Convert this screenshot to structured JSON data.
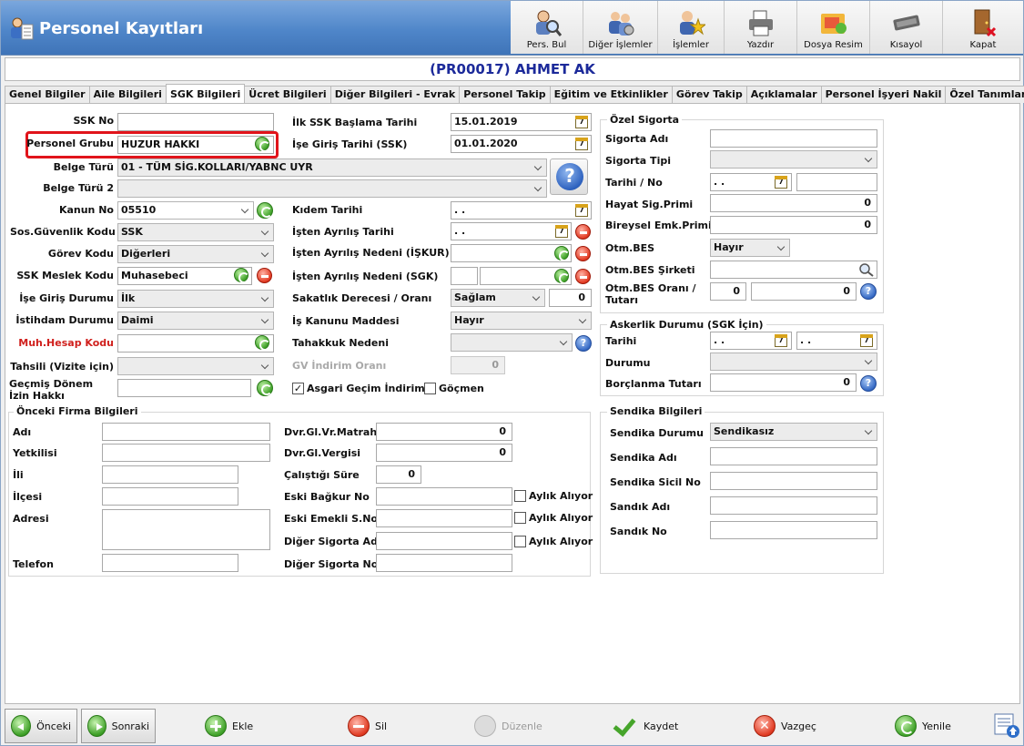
{
  "window": {
    "title": "Personel Kayıtları"
  },
  "toolbar": [
    {
      "label": "Pers. Bul",
      "icon": "person-search-icon"
    },
    {
      "label": "Diğer İşlemler",
      "icon": "people-gear-icon"
    },
    {
      "label": "İşlemler",
      "icon": "person-star-icon"
    },
    {
      "label": "Yazdır",
      "icon": "printer-icon"
    },
    {
      "label": "Dosya Resim",
      "icon": "folder-image-icon"
    },
    {
      "label": "Kısayol",
      "icon": "keyboard-icon"
    },
    {
      "label": "Kapat",
      "icon": "exit-door-icon"
    }
  ],
  "header": {
    "record_title": "(PR00017) AHMET AK"
  },
  "tabs": [
    "Genel Bilgiler",
    "Aile Bilgileri",
    "SGK Bilgileri",
    "Ücret Bilgileri",
    "Diğer Bilgileri - Evrak",
    "Personel Takip",
    "Eğitim ve Etkinlikler",
    "Görev Takip",
    "Açıklamalar",
    "Personel İşyeri Nakil",
    "Özel Tanımlar"
  ],
  "active_tab": "SGK Bilgileri",
  "sgk": {
    "ssk_no": {
      "label": "SSK No",
      "value": ""
    },
    "personel_grubu": {
      "label": "Personel Grubu",
      "value": "HUZUR HAKKI"
    },
    "belge_turu": {
      "label": "Belge Türü",
      "value": "01 - TÜM SİG.KOLLARI/YABNC UYR"
    },
    "belge_turu2": {
      "label": "Belge Türü 2",
      "value": ""
    },
    "kanun_no": {
      "label": "Kanun No",
      "value": "05510"
    },
    "sos_guvenlik": {
      "label": "Sos.Güvenlik Kodu",
      "value": "SSK"
    },
    "gorev_kodu": {
      "label": "Görev Kodu",
      "value": "Diğerleri"
    },
    "ssk_meslek": {
      "label": "SSK Meslek Kodu",
      "value": "Muhasebeci"
    },
    "ise_giris_durumu": {
      "label": "İşe Giriş Durumu",
      "value": "İlk"
    },
    "istihdam": {
      "label": "İstihdam Durumu",
      "value": "Daimi"
    },
    "muh_hesap": {
      "label": "Muh.Hesap Kodu",
      "value": ""
    },
    "tahsili": {
      "label": "Tahsili (Vizite için)",
      "value": ""
    },
    "gecmis_izin": {
      "label": "Geçmiş Dönem İzin Hakkı",
      "value": ""
    },
    "ilk_ssk": {
      "label": "İlk SSK Başlama Tarihi",
      "value": "15.01.2019"
    },
    "ise_giris_tarihi": {
      "label": "İşe Giriş Tarihi (SSK)",
      "value": "01.01.2020"
    },
    "kidem": {
      "label": "Kıdem Tarihi",
      "value": ". ."
    },
    "isten_ayrilis": {
      "label": "İşten Ayrılış Tarihi",
      "value": ". ."
    },
    "ayrilis_iskur": {
      "label": "İşten Ayrılış Nedeni (İŞKUR)",
      "value": ""
    },
    "ayrilis_sgk": {
      "label": "İşten Ayrılış Nedeni (SGK)",
      "value": ""
    },
    "sakatlik": {
      "label": "Sakatlık Derecesi / Oranı",
      "value": "Sağlam",
      "oran": "0"
    },
    "is_kanunu": {
      "label": "İş Kanunu Maddesi",
      "value": "Hayır"
    },
    "tahakkuk": {
      "label": "Tahakkuk Nedeni",
      "value": ""
    },
    "gv_indirim": {
      "label": "GV İndirim Oranı",
      "value": "0"
    },
    "asgari": {
      "label": "Asgari Geçim İndirimi",
      "checked": true
    },
    "gocmen": {
      "label": "Göçmen",
      "checked": false
    }
  },
  "onceki_firma": {
    "title": "Önceki Firma Bilgileri",
    "adi": "Adı",
    "yetkilisi": "Yetkilisi",
    "ili": "İli",
    "ilcesi": "İlçesi",
    "adresi": "Adresi",
    "telefon": "Telefon",
    "matrah_label": "Dvr.Gl.Vr.Matrahı",
    "matrah": "0",
    "vergi_label": "Dvr.Gl.Vergisi",
    "vergi": "0",
    "sure_label": "Çalıştığı Süre",
    "sure": "0",
    "bagkur_label": "Eski Bağkur No",
    "emekli_label": "Eski Emekli S.No",
    "sigorta_adi_label": "Diğer Sigorta Adı",
    "sigorta_no_label": "Diğer Sigorta No",
    "aylik_label": "Aylık Alıyor"
  },
  "ozel_sigorta": {
    "title": "Özel Sigorta",
    "sigorta_adi": "Sigorta Adı",
    "sigorta_tipi": "Sigorta Tipi",
    "tarih_no": "Tarihi / No",
    "tarih": ". .",
    "hayat_label": "Hayat Sig.Primi",
    "hayat": "0",
    "bireysel_label": "Bireysel Emk.Primi",
    "bireysel": "0",
    "otm_bes_label": "Otm.BES",
    "otm_bes": "Hayır",
    "otm_sirket_label": "Otm.BES Şirketi",
    "otm_oran_label": "Otm.BES Oranı / Tutarı",
    "otm_oran": "0",
    "otm_tutar": "0"
  },
  "askerlik": {
    "title": "Askerlik Durumu (SGK İçin)",
    "tarihi": "Tarihi",
    "tarih1": ". .",
    "tarih2": ". .",
    "durumu": "Durumu",
    "borc_label": "Borçlanma Tutarı",
    "borc": "0"
  },
  "sendika": {
    "title": "Sendika Bilgileri",
    "durum_label": "Sendika Durumu",
    "durum": "Sendikasız",
    "adi": "Sendika Adı",
    "sicil": "Sendika Sicil No",
    "sandik_adi": "Sandık Adı",
    "sandik_no": "Sandık No"
  },
  "footer": {
    "onceki": "Önceki",
    "sonraki": "Sonraki",
    "ekle": "Ekle",
    "sil": "Sil",
    "duzenle": "Düzenle",
    "kaydet": "Kaydet",
    "vazgec": "Vazgeç",
    "yenile": "Yenile"
  }
}
